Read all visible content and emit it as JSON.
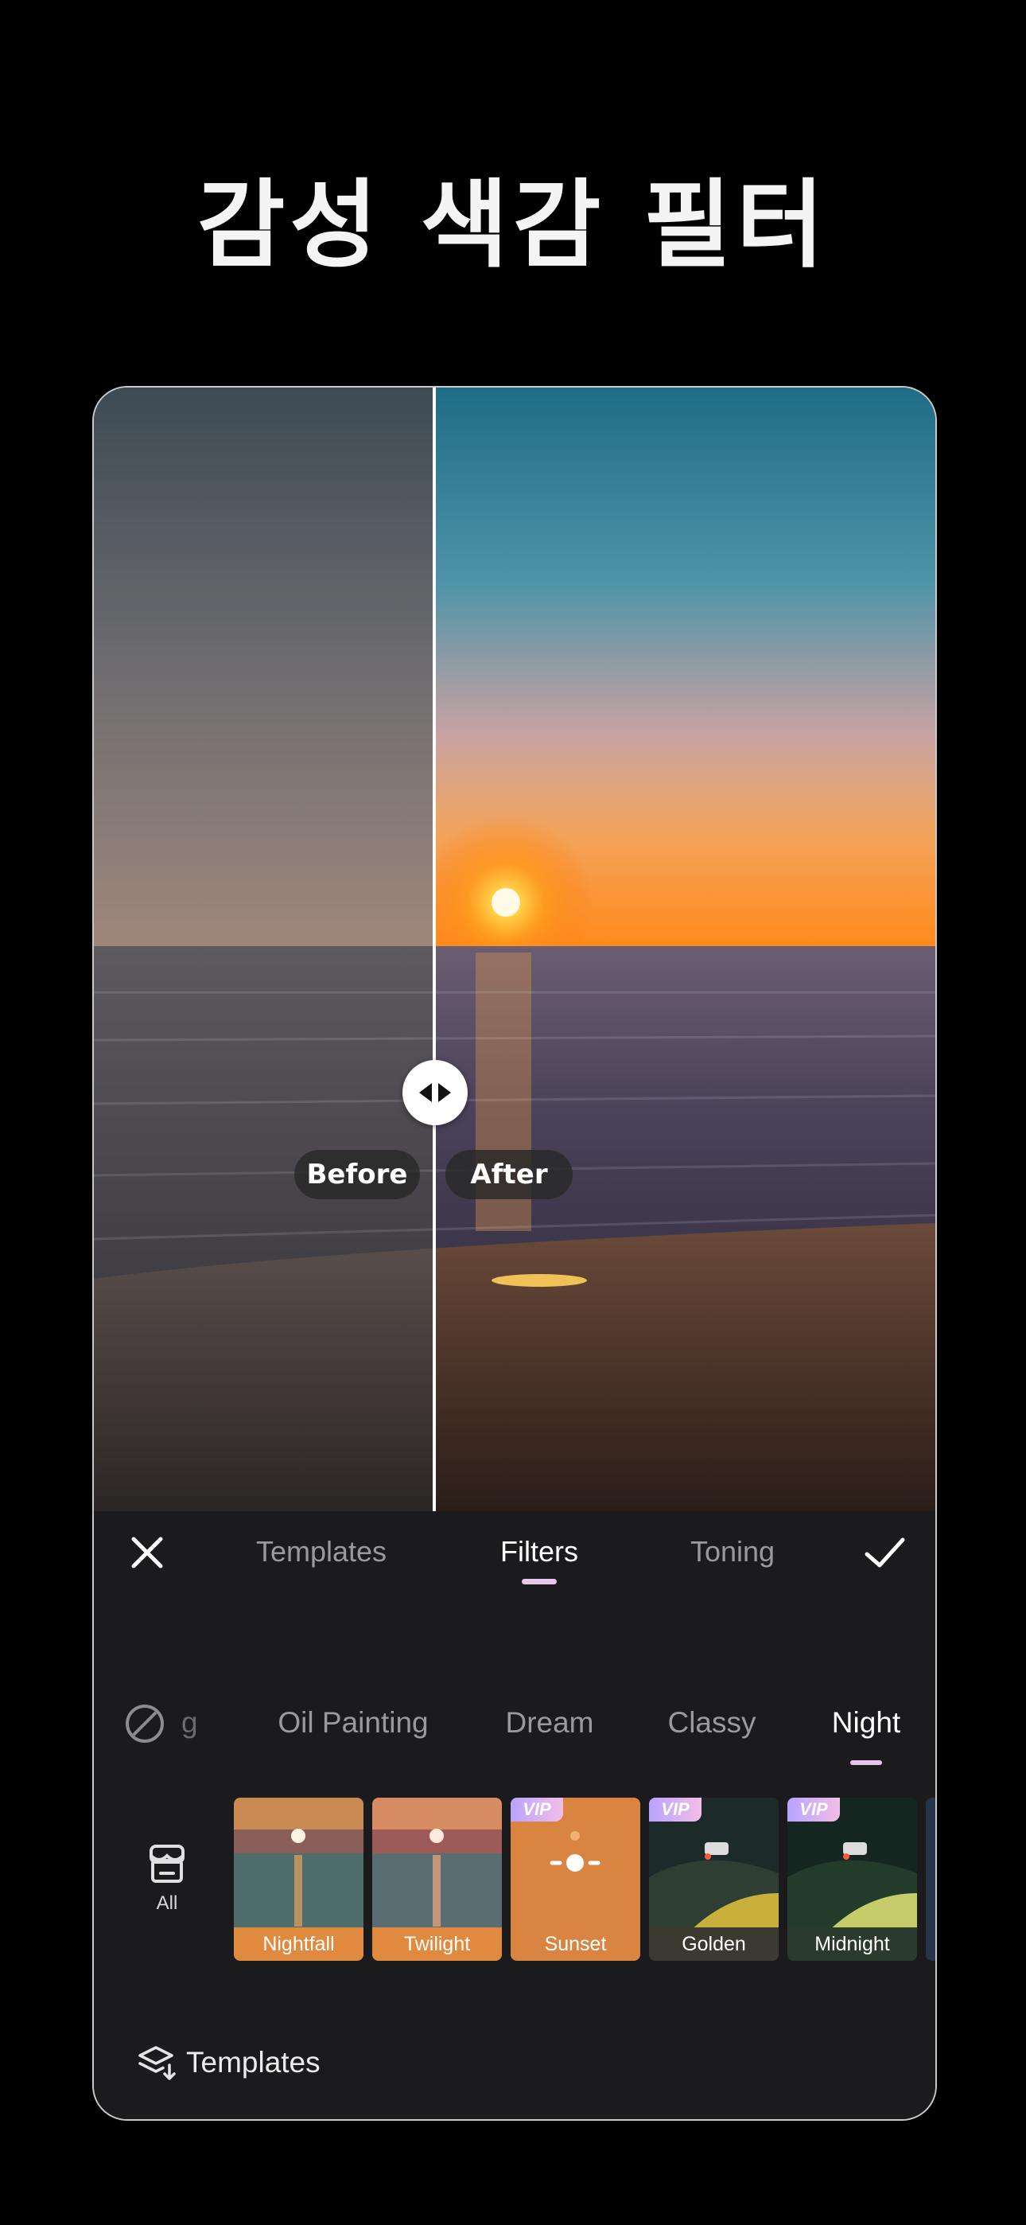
{
  "headline": "감성 색감 필터",
  "compare": {
    "before_label": "Before",
    "after_label": "After"
  },
  "tabs": [
    {
      "label": "Templates",
      "active": false
    },
    {
      "label": "Filters",
      "active": true
    },
    {
      "label": "Toning",
      "active": false
    }
  ],
  "categories": {
    "faded_partial": "g",
    "items": [
      {
        "label": "Oil Painting",
        "active": false
      },
      {
        "label": "Dream",
        "active": false
      },
      {
        "label": "Classy",
        "active": false
      },
      {
        "label": "Night",
        "active": true
      }
    ]
  },
  "all_button": {
    "label": "All",
    "icon": "store-icon"
  },
  "filters": [
    {
      "name": "Nightfall",
      "vip": false
    },
    {
      "name": "Twilight",
      "vip": false
    },
    {
      "name": "Sunset",
      "vip": true
    },
    {
      "name": "Golden",
      "vip": true
    },
    {
      "name": "Midnight",
      "vip": true
    }
  ],
  "vip_badge": "VIP",
  "bottom_link": {
    "label": "Templates",
    "icon": "layers-icon"
  },
  "colors": {
    "accent": "#e9c6ec",
    "panel_bg": "#1b1b1d",
    "inactive_text": "#9a9a9e"
  }
}
